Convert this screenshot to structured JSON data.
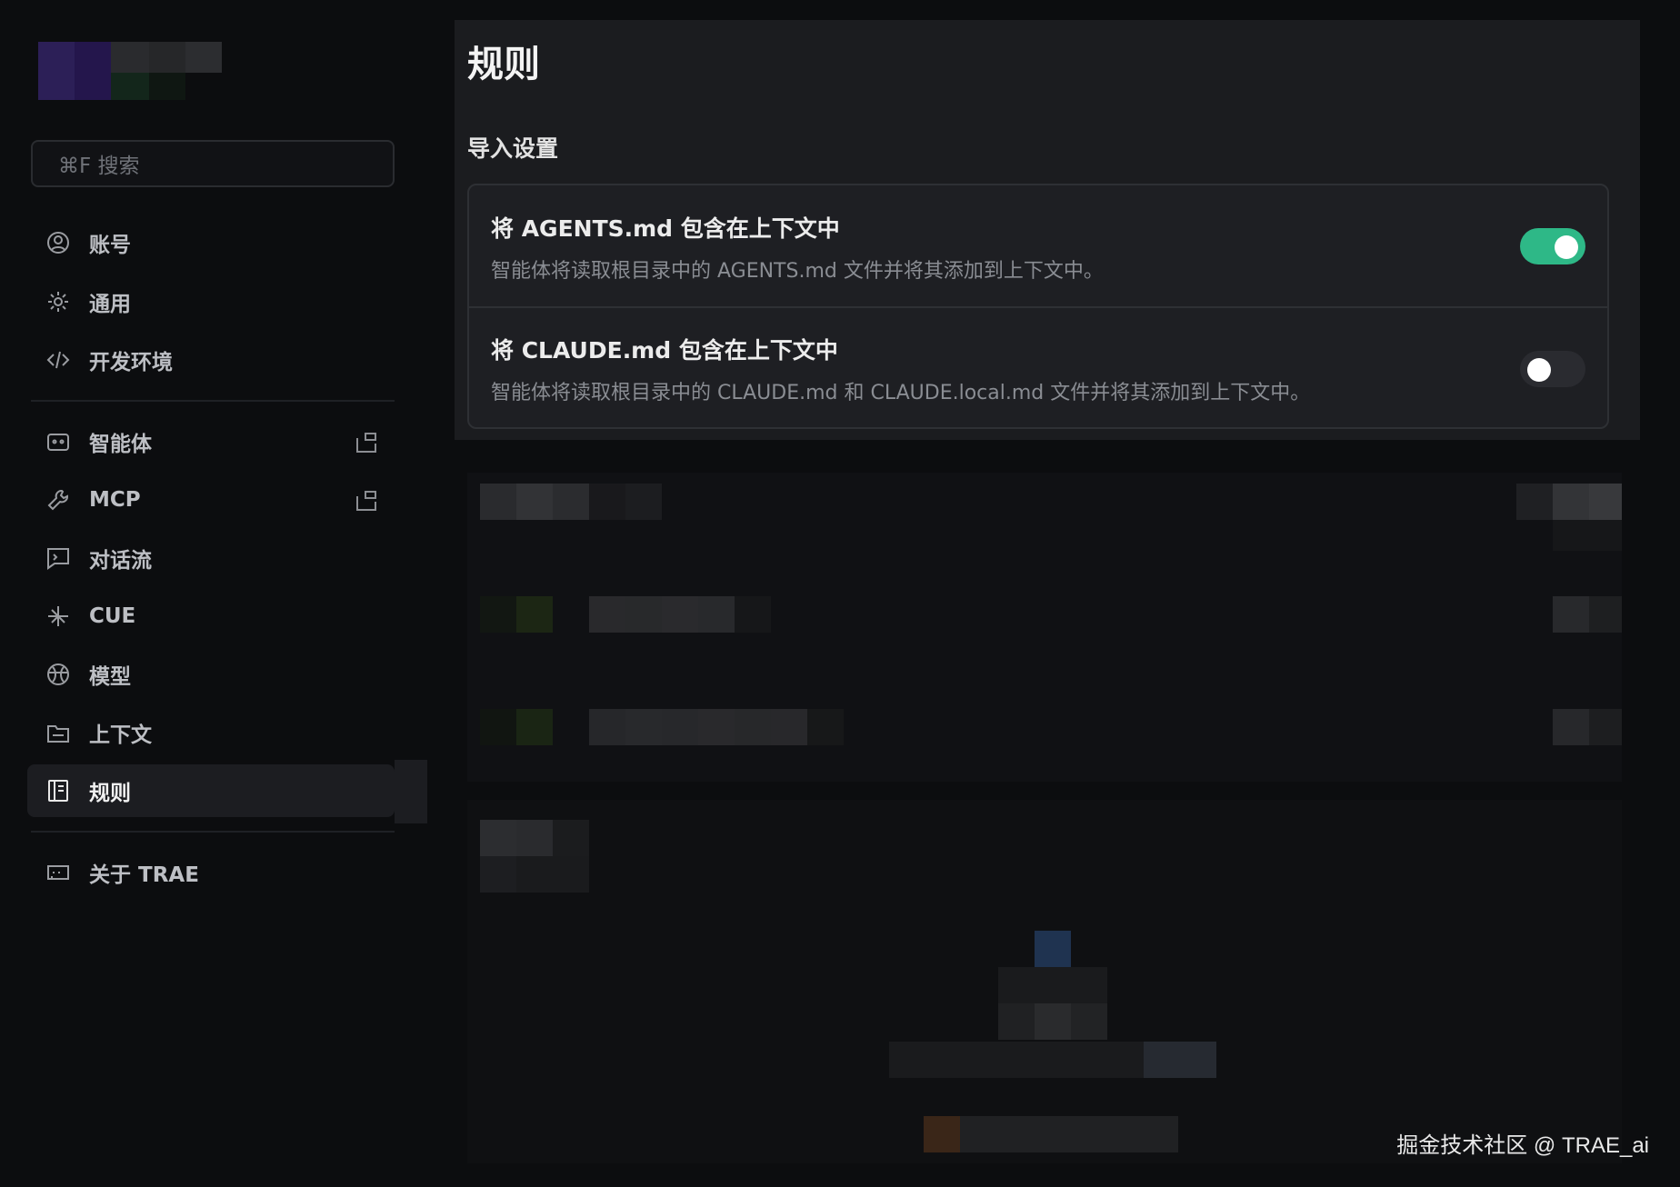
{
  "sidebar": {
    "search_placeholder": "⌘F 搜索",
    "group1": [
      {
        "label": "账号",
        "icon": "user-circle-icon"
      },
      {
        "label": "通用",
        "icon": "gear-icon"
      },
      {
        "label": "开发环境",
        "icon": "code-icon"
      }
    ],
    "group2": [
      {
        "label": "智能体",
        "icon": "robot-icon",
        "external": true
      },
      {
        "label": "MCP",
        "icon": "wrench-icon",
        "external": true
      },
      {
        "label": "对话流",
        "icon": "chat-flow-icon"
      },
      {
        "label": "CUE",
        "icon": "sparkle-icon"
      },
      {
        "label": "模型",
        "icon": "model-icon"
      },
      {
        "label": "上下文",
        "icon": "context-icon"
      },
      {
        "label": "规则",
        "icon": "rules-icon",
        "active": true
      }
    ],
    "group3": [
      {
        "label": "关于 TRAE",
        "icon": "trae-icon"
      }
    ]
  },
  "main": {
    "title": "规则",
    "import_section": {
      "title": "导入设置",
      "items": [
        {
          "title": "将 AGENTS.md 包含在上下文中",
          "description": "智能体将读取根目录中的 AGENTS.md 文件并将其添加到上下文中。",
          "enabled": true
        },
        {
          "title": "将 CLAUDE.md 包含在上下文中",
          "description": "智能体将读取根目录中的 CLAUDE.md 和 CLAUDE.local.md 文件并将其添加到上下文中。",
          "enabled": false
        }
      ]
    }
  },
  "colors": {
    "background": "#0c0d0f",
    "panel": "#1b1c1f",
    "toggle_on": "#2eb887",
    "toggle_off": "#2a2b30"
  },
  "watermark": "掘金技术社区 @ TRAE_ai"
}
